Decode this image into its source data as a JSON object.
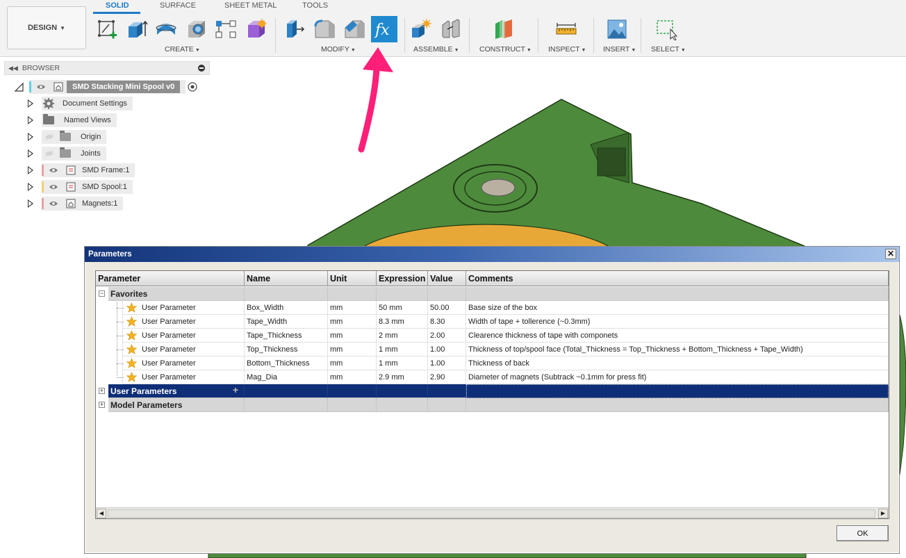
{
  "workspace": {
    "label": "DESIGN"
  },
  "tabs": [
    {
      "label": "SOLID",
      "active": true
    },
    {
      "label": "SURFACE"
    },
    {
      "label": "SHEET METAL"
    },
    {
      "label": "TOOLS"
    }
  ],
  "groups": {
    "create": "CREATE",
    "modify": "MODIFY",
    "assemble": "ASSEMBLE",
    "construct": "CONSTRUCT",
    "inspect": "INSPECT",
    "insert": "INSERT",
    "select": "SELECT"
  },
  "tools": {
    "highlighted": "change-parameters",
    "create": [
      "create-sketch-icon",
      "extrude-icon",
      "revolve-icon",
      "hole-icon",
      "pattern-icon",
      "create-form-icon"
    ],
    "modify": [
      "press-pull-icon",
      "fillet-icon",
      "chamfer-icon",
      "fx-parameters-icon"
    ],
    "assemble": [
      "new-component-icon",
      "joint-icon"
    ],
    "construct": [
      "offset-plane-icon"
    ],
    "inspect": [
      "measure-icon"
    ],
    "insert": [
      "insert-image-icon"
    ],
    "select": [
      "select-window-icon"
    ]
  },
  "browser": {
    "title": "BROWSER",
    "root": {
      "label": "SMD Stacking Mini Spool v0"
    },
    "items": [
      {
        "label": "Document Settings",
        "icon": "gear-icon"
      },
      {
        "label": "Named Views",
        "icon": "folder-icon"
      },
      {
        "label": "Origin",
        "icon": "folder-icon",
        "hidden": true
      },
      {
        "label": "Joints",
        "icon": "folder-icon",
        "hidden": true
      },
      {
        "label": "SMD Frame:1",
        "icon": "component-icon",
        "color": "#e8a0a0"
      },
      {
        "label": "SMD Spool:1",
        "icon": "component-icon",
        "color": "#f0d070"
      },
      {
        "label": "Magnets:1",
        "icon": "component-icon",
        "color": "#e8a0a0"
      }
    ]
  },
  "colors": {
    "accent": "#1d7ac6",
    "model_green": "#4e8a3c",
    "model_orange": "#e8a838",
    "arrow": "#ff1f78",
    "selected_row": "#0e2e78"
  },
  "dialog": {
    "title": "Parameters",
    "close": "✕",
    "ok_label": "OK",
    "columns": [
      "Parameter",
      "Name",
      "Unit",
      "Expression",
      "Value",
      "Comments"
    ],
    "groups": [
      {
        "label": "Favorites",
        "expanded": true,
        "rows": [
          {
            "parameter": "User Parameter",
            "name": "Box_Width",
            "unit": "mm",
            "expression": "50 mm",
            "value": "50.00",
            "comment": "Base size of the box"
          },
          {
            "parameter": "User Parameter",
            "name": "Tape_Width",
            "unit": "mm",
            "expression": "8.3 mm",
            "value": "8.30",
            "comment": "Width of tape + tollerence (~0.3mm)"
          },
          {
            "parameter": "User Parameter",
            "name": "Tape_Thickness",
            "unit": "mm",
            "expression": "2 mm",
            "value": "2.00",
            "comment": "Clearence thickness of tape with componets"
          },
          {
            "parameter": "User Parameter",
            "name": "Top_Thickness",
            "unit": "mm",
            "expression": "1 mm",
            "value": "1.00",
            "comment": "Thickness of top/spool face (Total_Thickness = Top_Thickness + Bottom_Thickness + Tape_Width)"
          },
          {
            "parameter": "User Parameter",
            "name": "Bottom_Thickness",
            "unit": "mm",
            "expression": "1 mm",
            "value": "1.00",
            "comment": "Thickness of back"
          },
          {
            "parameter": "User Parameter",
            "name": "Mag_Dia",
            "unit": "mm",
            "expression": "2.9 mm",
            "value": "2.90",
            "comment": "Diameter of magnets (Subtrack ~0.1mm for press fit)"
          }
        ]
      },
      {
        "label": "User Parameters",
        "expanded": false,
        "selected": true
      },
      {
        "label": "Model Parameters",
        "expanded": false
      }
    ]
  }
}
